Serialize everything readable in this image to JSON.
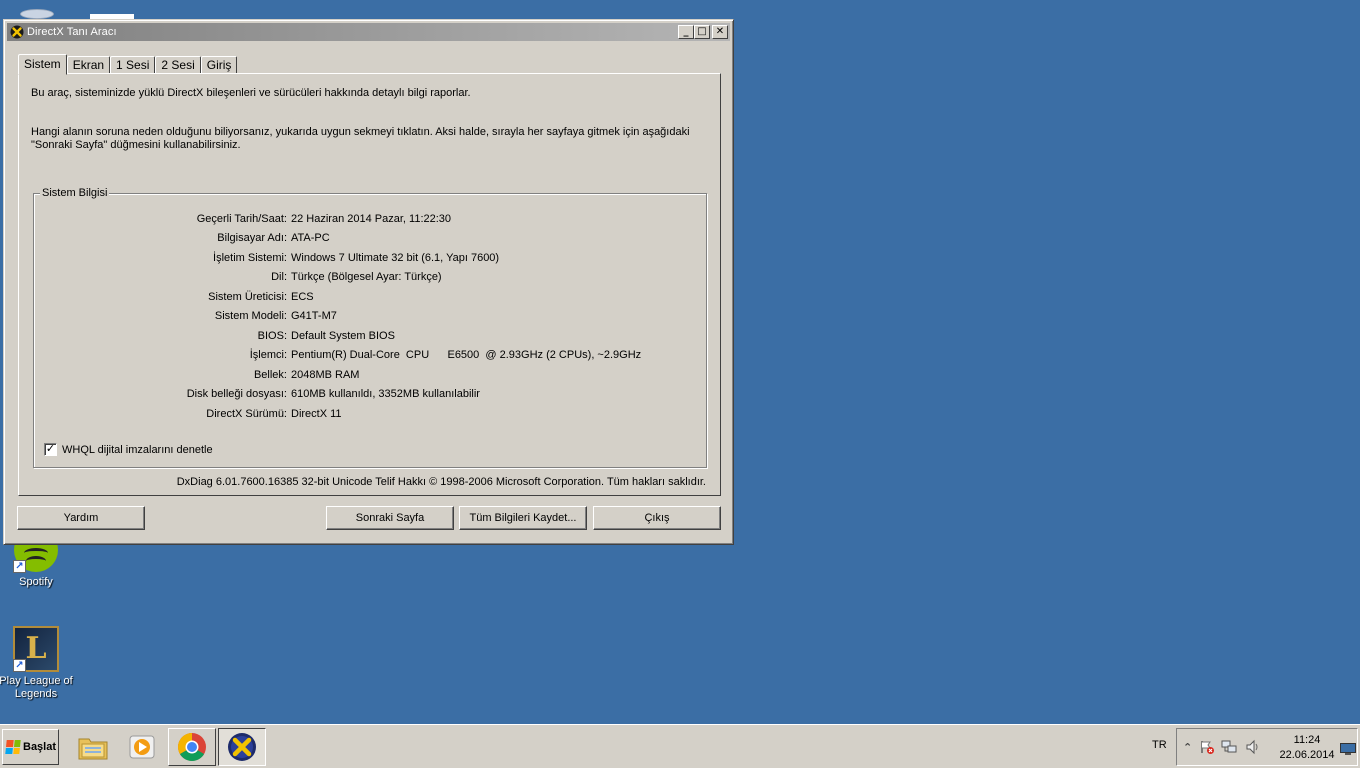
{
  "desktop": {
    "icons": [
      {
        "label": "Spotify"
      },
      {
        "label": "Play League of Legends"
      }
    ]
  },
  "window": {
    "title": "DirectX Tanı Aracı",
    "controls": {
      "minimize": "_",
      "maximize": "□",
      "close": "✕"
    },
    "tabs": [
      {
        "label": "Sistem",
        "active": true
      },
      {
        "label": "Ekran"
      },
      {
        "label": "1 Sesi"
      },
      {
        "label": "2 Sesi"
      },
      {
        "label": "Giriş"
      }
    ],
    "intro_line1": "Bu araç, sisteminizde yüklü DirectX bileşenleri ve sürücüleri hakkında detaylı bilgi raporlar.",
    "intro_line2": "Hangi alanın soruna neden olduğunu biliyorsanız, yukarıda uygun sekmeyi tıklatın.  Aksi halde, sırayla her sayfaya gitmek için aşağıdaki",
    "intro_line3": "\"Sonraki Sayfa\" düğmesini kullanabilirsiniz.",
    "group_title": "Sistem Bilgisi",
    "system_info": [
      {
        "label": "Geçerli Tarih/Saat:",
        "value": "22 Haziran 2014 Pazar, 11:22:30"
      },
      {
        "label": "Bilgisayar Adı:",
        "value": "ATA-PC"
      },
      {
        "label": "İşletim Sistemi:",
        "value": "Windows 7 Ultimate 32 bit (6.1, Yapı 7600)"
      },
      {
        "label": "Dil:",
        "value": "Türkçe (Bölgesel Ayar: Türkçe)"
      },
      {
        "label": "Sistem Üreticisi:",
        "value": "ECS"
      },
      {
        "label": "Sistem Modeli:",
        "value": "G41T-M7"
      },
      {
        "label": "BIOS:",
        "value": "Default System BIOS"
      },
      {
        "label": "İşlemci:",
        "value": "Pentium(R) Dual-Core  CPU      E6500  @ 2.93GHz (2 CPUs), ~2.9GHz"
      },
      {
        "label": "Bellek:",
        "value": "2048MB RAM"
      },
      {
        "label": "Disk belleği dosyası:",
        "value": "610MB kullanıldı, 3352MB kullanılabilir"
      },
      {
        "label": "DirectX Sürümü:",
        "value": "DirectX 11"
      }
    ],
    "whql_checkbox": {
      "label": "WHQL dijital imzalarını denetle",
      "checked": true,
      "mark": "✓"
    },
    "copyright": "DxDiag 6.01.7600.16385 32-bit Unicode  Telif Hakkı © 1998-2006 Microsoft Corporation.  Tüm hakları saklıdır.",
    "buttons": {
      "help": "Yardım",
      "next_page": "Sonraki Sayfa",
      "save_all": "Tüm Bilgileri Kaydet...",
      "exit": "Çıkış"
    }
  },
  "taskbar": {
    "start_label": "Başlat",
    "language": "TR",
    "tray_expand": "⌃",
    "clock_time": "11:24",
    "clock_date": "22.06.2014"
  },
  "colors": {
    "desktop": "#3b6ea5",
    "window_face": "#d4d0c8",
    "titlebar_inactive": "#808080"
  }
}
